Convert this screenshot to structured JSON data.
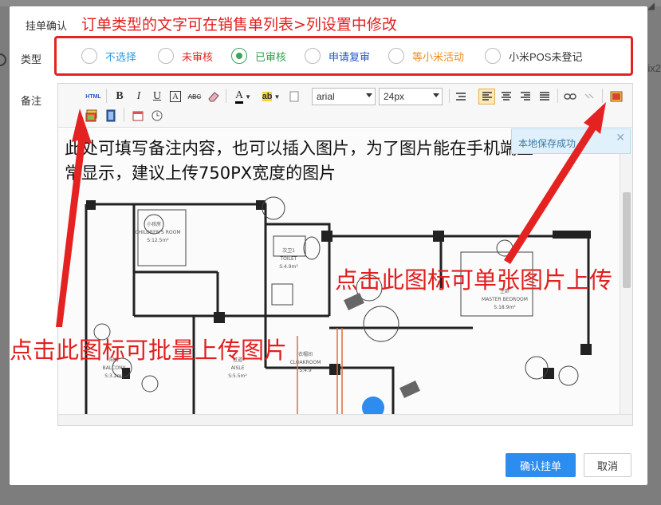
{
  "background": {
    "partial_text": "ix2"
  },
  "dialog": {
    "title": "挂单确认",
    "annotation_top": "订单类型的文字可在销售单列表>列设置中修改",
    "type_label": "类型",
    "notes_label": "备注"
  },
  "radio_options": [
    {
      "label": "不选择",
      "color": "#2f9ae0",
      "checked": false
    },
    {
      "label": "未审核",
      "color": "#e02828",
      "checked": false
    },
    {
      "label": "已审核",
      "color": "#2f9e4f",
      "checked": true
    },
    {
      "label": "申请复审",
      "color": "#2458c8",
      "checked": false
    },
    {
      "label": "等小米活动",
      "color": "#f08a1c",
      "checked": false
    },
    {
      "label": "小米POS未登记",
      "color": "#333333",
      "checked": false
    }
  ],
  "editor": {
    "toolbar": {
      "html_label": "HTML",
      "font_family": "arial",
      "font_size": "24px",
      "bold": "B",
      "italic": "I",
      "underline": "U",
      "strike": "ABC",
      "font_color": "A"
    },
    "content_text": "此处可填写备注内容，也可以插入图片，为了图片能在手机端正常显示，建议上传750PX宽度的图片",
    "save_tip": "本地保存成功",
    "floorplan_labels": {
      "children_room": "小孩房",
      "children_room_en": "CHILDREN'S ROOM",
      "children_room_area": "S:12.5m²",
      "toilet_cn": "次卫1",
      "toilet_en": "TOILET",
      "toilet_area": "S:4.9m²",
      "master_cn": "主卧",
      "master_en": "MASTER BEDROOM",
      "master_area": "S:18.9m²",
      "balcony_cn": "阳台",
      "balcony_en": "BALCONY",
      "balcony_area": "S:3.2m²",
      "aisle_cn": "过道",
      "aisle_en": "AISLE",
      "aisle_area": "S:5.5m²",
      "cloak_cn": "衣帽间",
      "cloak_en": "CLOAKROOM",
      "cloak_area": "S:4.9"
    }
  },
  "annotations": {
    "single_upload": "点击此图标可单张图片上传",
    "batch_upload": "点击此图标可批量上传图片"
  },
  "buttons": {
    "confirm": "确认挂单",
    "cancel": "取消"
  },
  "colors": {
    "annotation_red": "#e31e1e",
    "primary_blue": "#2d8cf0",
    "checked_green": "#3ba55c"
  }
}
